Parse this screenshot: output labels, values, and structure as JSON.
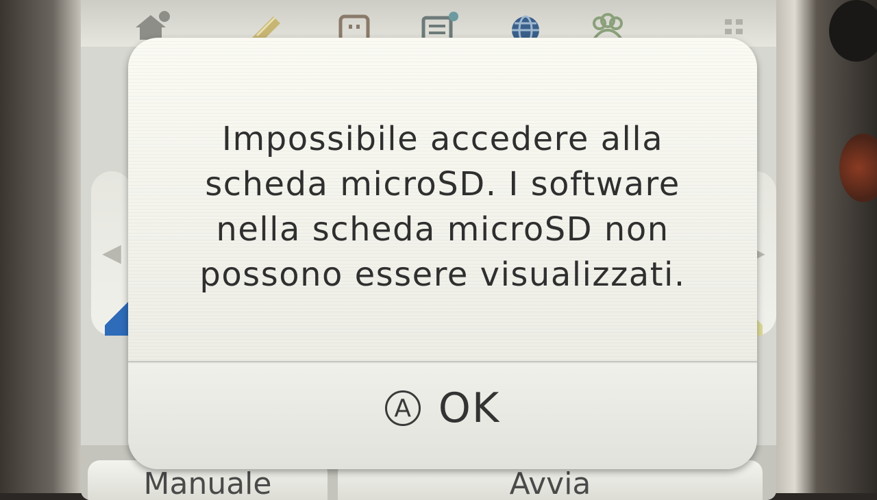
{
  "dialog": {
    "message": "Impossibile accedere alla\nscheda microSD. I software\nnella scheda microSD non\npossono essere visualizzati.",
    "ok_button": {
      "badge": "A",
      "label": "OK"
    }
  },
  "bottom_bar": {
    "left_label": "Manuale",
    "right_label": "Avvia"
  },
  "toolbar": {
    "icons": [
      "home-settings-icon",
      "notes-icon",
      "character-face-icon",
      "news-icon",
      "internet-browser-icon",
      "friends-icon",
      "grid-menu-icon"
    ]
  },
  "colors": {
    "dialog_background": "#f4f4ed",
    "text": "#2f2f2f",
    "screen_background": "#d7d7d1"
  }
}
